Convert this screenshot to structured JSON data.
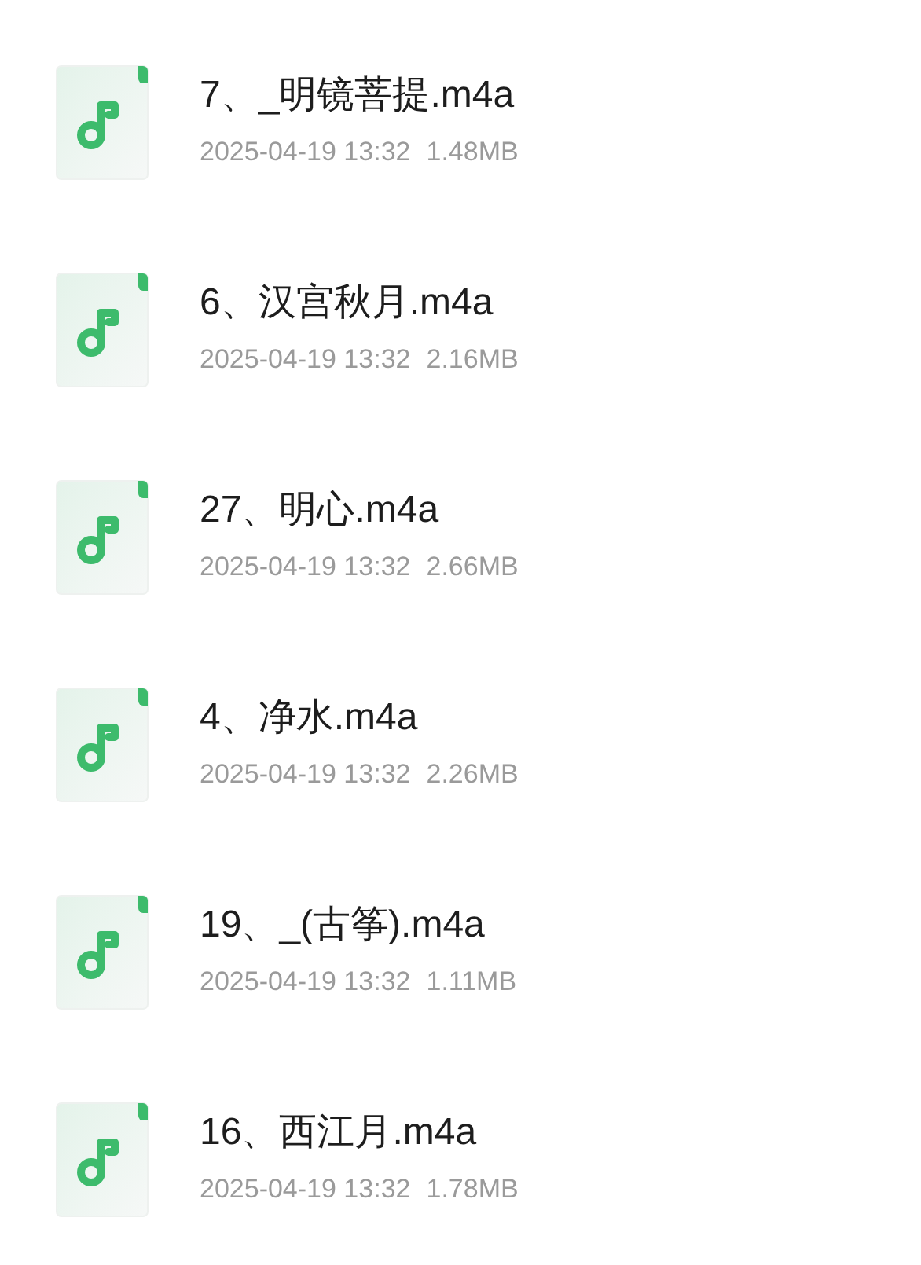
{
  "files": [
    {
      "name": "7、_明镜菩提.m4a",
      "date": "2025-04-19 13:32",
      "size": "1.48MB"
    },
    {
      "name": "6、汉宫秋月.m4a",
      "date": "2025-04-19 13:32",
      "size": "2.16MB"
    },
    {
      "name": "27、明心.m4a",
      "date": "2025-04-19 13:32",
      "size": "2.66MB"
    },
    {
      "name": "4、净水.m4a",
      "date": "2025-04-19 13:32",
      "size": "2.26MB"
    },
    {
      "name": "19、_(古筝).m4a",
      "date": "2025-04-19 13:32",
      "size": "1.11MB"
    },
    {
      "name": "16、西江月.m4a",
      "date": "2025-04-19 13:32",
      "size": "1.78MB"
    }
  ]
}
